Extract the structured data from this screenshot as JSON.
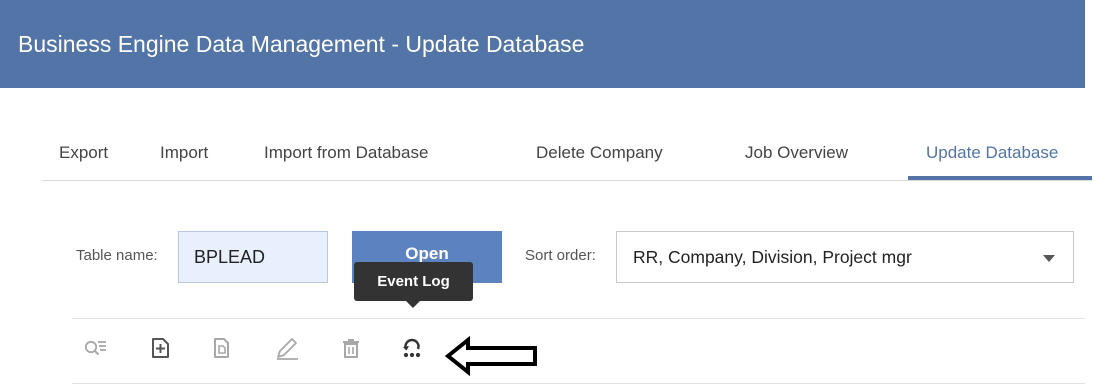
{
  "header": {
    "title": "Business Engine Data Management - Update Database",
    "background": "#5274a6"
  },
  "tabs": [
    {
      "label": "Export"
    },
    {
      "label": "Import"
    },
    {
      "label": "Import from Database"
    },
    {
      "label": "Delete Company"
    },
    {
      "label": "Job Overview"
    },
    {
      "label": "Update Database",
      "active": true
    }
  ],
  "form": {
    "table_name_label": "Table name:",
    "table_name_value": "BPLEAD",
    "open_button_label": "Open",
    "sort_order_label": "Sort order:",
    "sort_order_value": "RR, Company, Division, Project mgr"
  },
  "tooltip": {
    "text": "Event Log"
  },
  "toolbar": {
    "icons": [
      "search-list-icon",
      "new-record-icon",
      "copy-record-icon",
      "edit-icon",
      "delete-icon",
      "event-log-icon"
    ]
  },
  "colors": {
    "accent": "#5274a6",
    "button": "#5c83c0",
    "input_bg": "#e8f0fe"
  }
}
